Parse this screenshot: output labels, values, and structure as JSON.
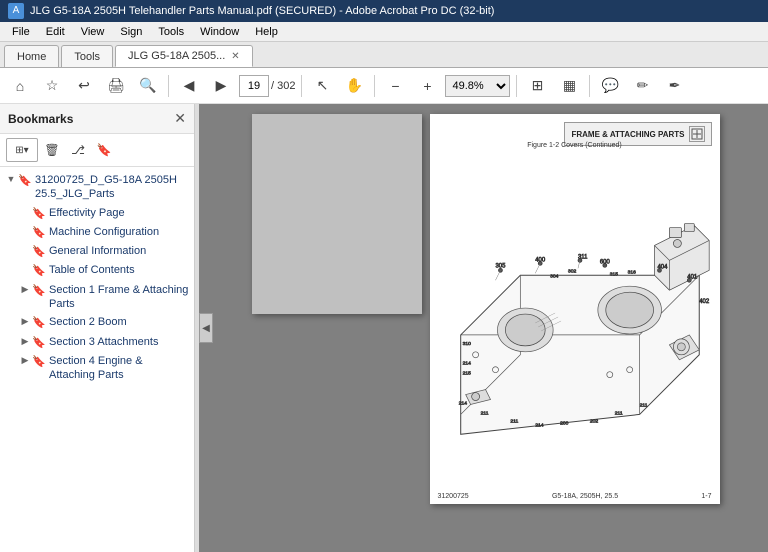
{
  "titleBar": {
    "text": "JLG G5-18A 2505H Telehandler Parts Manual.pdf (SECURED) - Adobe Acrobat Pro DC (32-bit)"
  },
  "menuBar": {
    "items": [
      "File",
      "Edit",
      "View",
      "Sign",
      "Tools",
      "Window",
      "Help"
    ]
  },
  "tabs": [
    {
      "label": "Home",
      "active": false,
      "closable": false
    },
    {
      "label": "Tools",
      "active": false,
      "closable": false
    },
    {
      "label": "JLG G5-18A 2505...",
      "active": true,
      "closable": true
    }
  ],
  "toolbar": {
    "pageNumber": "19",
    "totalPages": "302",
    "zoomLevel": "49.8%"
  },
  "sidebar": {
    "title": "Bookmarks",
    "bookmarks": [
      {
        "id": "root",
        "label": "31200725_D_G5-18A 2505H 25.5_JLG_Parts",
        "expanded": true,
        "children": [
          {
            "id": "effectivity",
            "label": "Effectivity Page"
          },
          {
            "id": "machine-config",
            "label": "Machine Configuration"
          },
          {
            "id": "general-info",
            "label": "General Information"
          },
          {
            "id": "toc",
            "label": "Table of Contents"
          },
          {
            "id": "section1",
            "label": "Section 1 Frame & Attaching Parts",
            "expanded": false
          },
          {
            "id": "section2",
            "label": "Section 2 Boom",
            "expanded": false
          },
          {
            "id": "section3",
            "label": "Section 3 Attachments",
            "expanded": false
          },
          {
            "id": "section4",
            "label": "Section 4 Engine & Attaching Parts",
            "expanded": false
          }
        ]
      }
    ]
  },
  "pdfContent": {
    "headerLabel": "FRAME & ATTACHING PARTS",
    "figureCaption": "Figure 1-2 Covers (Continued)",
    "footerLeft": "31200725",
    "footerCenter": "G5-18A, 2505H, 25.5",
    "footerRight": "1-7"
  },
  "icons": {
    "home": "⌂",
    "bookmark": "★",
    "previous": "◀",
    "next": "▶",
    "hand": "✋",
    "arrow": "↖",
    "zoomIn": "+",
    "zoomOut": "−",
    "print": "🖨",
    "chevronRight": "▶",
    "chevronDown": "▼",
    "bookmarkOutline": "🔖",
    "close": "✕",
    "search": "🔍"
  }
}
